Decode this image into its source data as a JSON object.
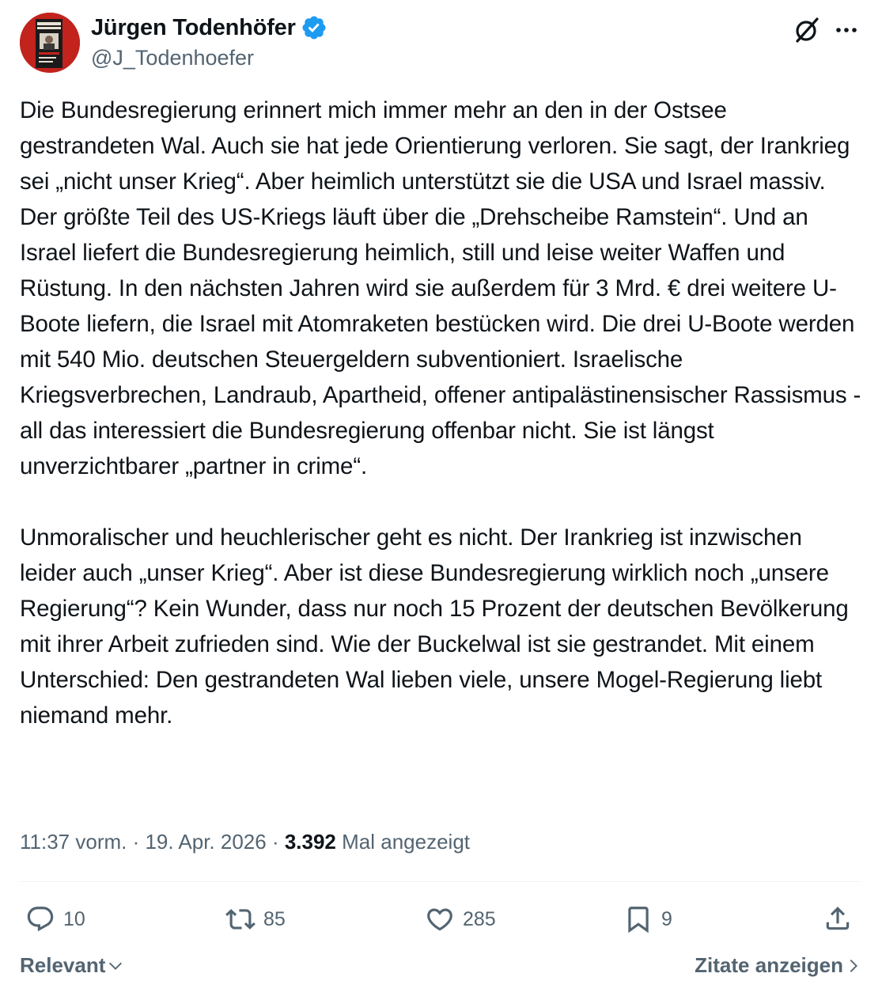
{
  "author": {
    "display_name": "Jürgen Todenhöfer",
    "handle": "@J_Todenhoefer",
    "verified": true,
    "avatar_icon": "book-cover-avatar"
  },
  "icons": {
    "grok": "grok-icon",
    "more": "more-icon"
  },
  "tweet": {
    "paragraph_1": "Die Bundesregierung erinnert mich immer mehr an den in der Ostsee gestrandeten Wal. Auch sie hat jede Orientierung verloren. Sie sagt, der Irankrieg sei „nicht unser Krieg“. Aber heimlich unterstützt sie die USA und Israel massiv. Der größte Teil des US-Kriegs läuft über die „Drehscheibe Ramstein“. Und an Israel liefert die Bundesregierung heimlich, still und leise weiter Waffen und Rüstung. In den nächsten Jahren wird sie außerdem für 3 Mrd. € drei weitere U-Boote liefern, die Israel mit Atomraketen bestücken wird. Die drei U-Boote werden mit 540 Mio. deutschen Steuergeldern subventioniert. Israelische Kriegsverbrechen, Landraub, Apartheid, offener antipalästinensischer Rassismus - all das interessiert die Bundesregierung offenbar nicht. Sie ist längst unverzichtbarer „partner in crime“.",
    "paragraph_2": "Unmoralischer und heuchlerischer geht es nicht. Der Irankrieg ist inzwischen leider auch „unser Krieg“. Aber ist diese Bundesregierung wirklich noch „unsere Regierung“? Kein Wunder, dass nur noch 15 Prozent der deutschen Bevölkerung mit ihrer Arbeit zufrieden sind. Wie der Buckelwal ist sie gestrandet. Mit einem Unterschied: Den gestrandeten Wal lieben viele, unsere Mogel-Regierung liebt niemand mehr."
  },
  "meta": {
    "time": "11:37 vorm.",
    "separator": " · ",
    "date": "19. Apr. 2026",
    "views_count": "3.392",
    "views_label": "Mal angezeigt"
  },
  "actions": {
    "replies": "10",
    "reposts": "85",
    "likes": "285",
    "bookmarks": "9"
  },
  "footer": {
    "sort_label": "Relevant",
    "quotes_label": "Zitate anzeigen"
  },
  "colors": {
    "text": "#0f1419",
    "secondary": "#536471",
    "verified_blue": "#1d9bf0",
    "divider": "#eff3f4"
  }
}
